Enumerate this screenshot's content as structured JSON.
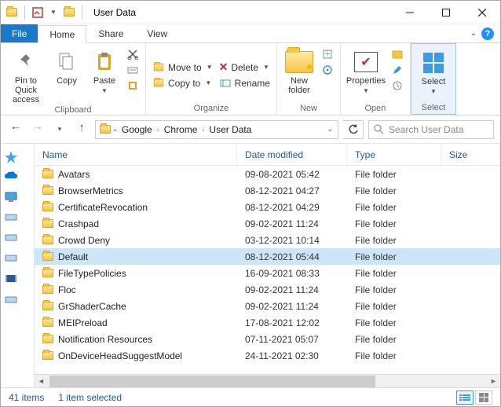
{
  "titlebar": {
    "app_title": "User Data"
  },
  "tabs": {
    "file": "File",
    "home": "Home",
    "share": "Share",
    "view": "View"
  },
  "ribbon": {
    "clipboard": {
      "label": "Clipboard",
      "pin": "Pin to Quick access",
      "copy": "Copy",
      "paste": "Paste"
    },
    "organize": {
      "label": "Organize",
      "move_to": "Move to",
      "copy_to": "Copy to",
      "delete": "Delete",
      "rename": "Rename"
    },
    "new": {
      "label": "New",
      "new_folder": "New folder"
    },
    "open": {
      "label": "Open",
      "properties": "Properties"
    },
    "select": {
      "label": "Select",
      "select": "Select"
    }
  },
  "breadcrumb": {
    "items": [
      "Google",
      "Chrome",
      "User Data"
    ]
  },
  "search": {
    "placeholder": "Search User Data"
  },
  "columns": {
    "name": "Name",
    "date": "Date modified",
    "type": "Type",
    "size": "Size"
  },
  "type_folder": "File folder",
  "rows": [
    {
      "name": "Avatars",
      "date": "09-08-2021 05:42",
      "type": "File folder",
      "selected": false
    },
    {
      "name": "BrowserMetrics",
      "date": "08-12-2021 04:27",
      "type": "File folder",
      "selected": false
    },
    {
      "name": "CertificateRevocation",
      "date": "08-12-2021 04:29",
      "type": "File folder",
      "selected": false
    },
    {
      "name": "Crashpad",
      "date": "09-02-2021 11:24",
      "type": "File folder",
      "selected": false
    },
    {
      "name": "Crowd Deny",
      "date": "03-12-2021 10:14",
      "type": "File folder",
      "selected": false
    },
    {
      "name": "Default",
      "date": "08-12-2021 05:44",
      "type": "File folder",
      "selected": true
    },
    {
      "name": "FileTypePolicies",
      "date": "16-09-2021 08:33",
      "type": "File folder",
      "selected": false
    },
    {
      "name": "Floc",
      "date": "09-02-2021 11:24",
      "type": "File folder",
      "selected": false
    },
    {
      "name": "GrShaderCache",
      "date": "09-02-2021 11:24",
      "type": "File folder",
      "selected": false
    },
    {
      "name": "MEIPreload",
      "date": "17-08-2021 12:02",
      "type": "File folder",
      "selected": false
    },
    {
      "name": "Notification Resources",
      "date": "07-11-2021 05:07",
      "type": "File folder",
      "selected": false
    },
    {
      "name": "OnDeviceHeadSuggestModel",
      "date": "24-11-2021 02:30",
      "type": "File folder",
      "selected": false
    }
  ],
  "status": {
    "items": "41 items",
    "selected": "1 item selected"
  }
}
